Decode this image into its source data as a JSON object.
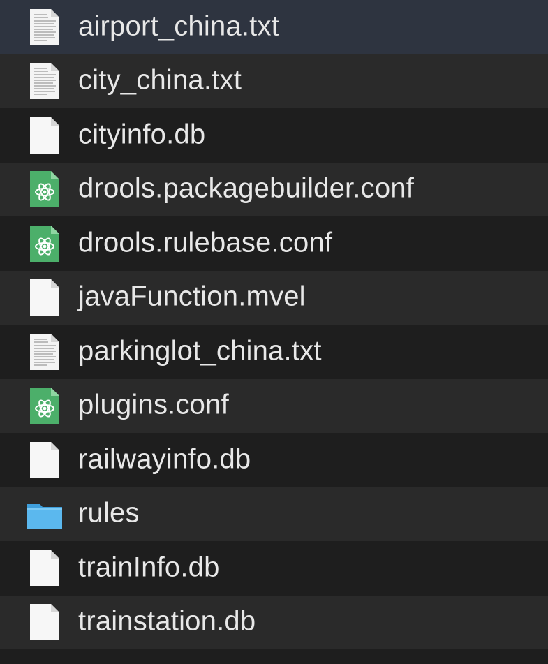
{
  "files": [
    {
      "name": "airport_china.txt",
      "icon": "text-file-icon"
    },
    {
      "name": "city_china.txt",
      "icon": "text-file-icon"
    },
    {
      "name": "cityinfo.db",
      "icon": "blank-file-icon"
    },
    {
      "name": "drools.packagebuilder.conf",
      "icon": "atom-file-icon"
    },
    {
      "name": "drools.rulebase.conf",
      "icon": "atom-file-icon"
    },
    {
      "name": "javaFunction.mvel",
      "icon": "blank-file-icon"
    },
    {
      "name": "parkinglot_china.txt",
      "icon": "text-file-icon"
    },
    {
      "name": "plugins.conf",
      "icon": "atom-file-icon"
    },
    {
      "name": "railwayinfo.db",
      "icon": "blank-file-icon"
    },
    {
      "name": "rules",
      "icon": "folder-icon"
    },
    {
      "name": "trainInfo.db",
      "icon": "blank-file-icon"
    },
    {
      "name": "trainstation.db",
      "icon": "blank-file-icon"
    }
  ],
  "colors": {
    "background": "#232323",
    "row_dark": "#1e1e1e",
    "row_light": "#2a2a2a",
    "text": "#e8e8e8",
    "folder": "#5bb8ee",
    "atom_green": "#4caf6a"
  }
}
